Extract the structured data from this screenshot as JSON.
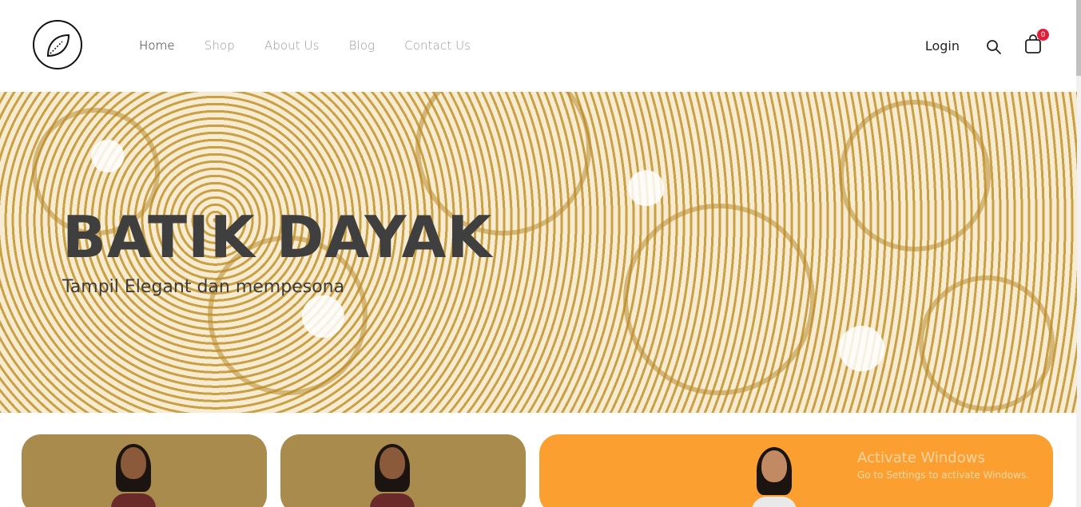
{
  "nav": {
    "items": [
      {
        "label": "Home",
        "active": true
      },
      {
        "label": "Shop",
        "active": false
      },
      {
        "label": "About Us",
        "active": false
      },
      {
        "label": "Blog",
        "active": false
      },
      {
        "label": "Contact Us",
        "active": false
      }
    ]
  },
  "header": {
    "login_label": "Login",
    "cart_count": "0",
    "logo_icon": "leaf-icon",
    "search_icon": "search-icon",
    "cart_icon": "shopping-bag-icon"
  },
  "hero": {
    "title": "BATIK DAYAK",
    "subtitle": "Tampil Elegant dan mempesona"
  },
  "watermark": {
    "line1": "Activate Windows",
    "line2": "Go to Settings to activate Windows."
  },
  "colors": {
    "badge": "#e0203a",
    "card_brown": "#a88b4d",
    "card_orange": "#fba030"
  }
}
